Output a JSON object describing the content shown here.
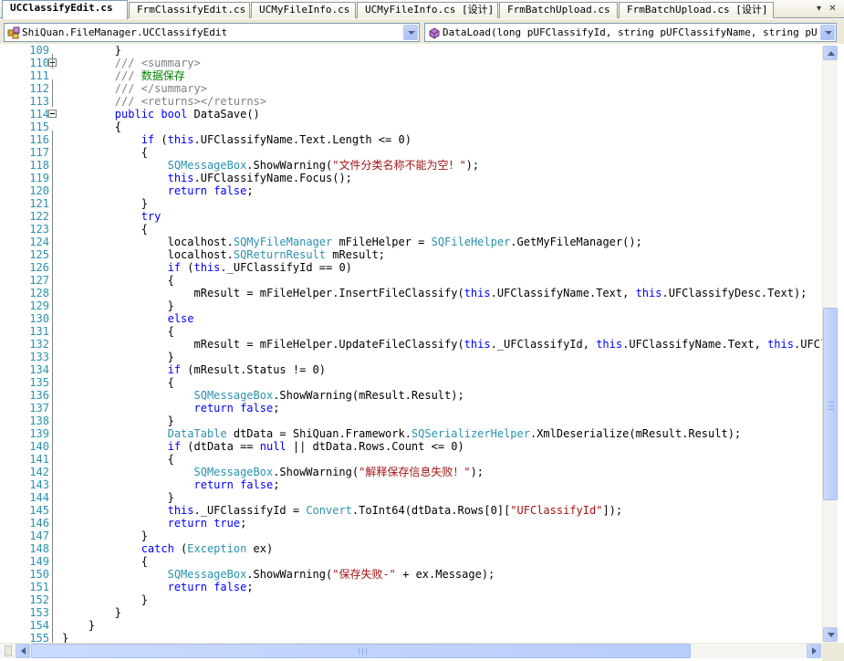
{
  "tabs": [
    {
      "label": "UCClassifyEdit.cs",
      "active": true
    },
    {
      "label": "FrmClassifyEdit.cs",
      "active": false
    },
    {
      "label": "UCMyFileInfo.cs",
      "active": false
    },
    {
      "label": "UCMyFileInfo.cs [设计]",
      "active": false
    },
    {
      "label": "FrmBatchUpload.cs",
      "active": false
    },
    {
      "label": "FrmBatchUpload.cs [设计]",
      "active": false
    }
  ],
  "tab_controls": {
    "dropdown_icon": "chevron-down-icon",
    "close_icon": "close-icon"
  },
  "navbar": {
    "class_combo": {
      "value": "ShiQuan.FileManager.UCClassifyEdit",
      "icon": "class-icon"
    },
    "member_combo": {
      "value": "DataLoad(long pUFClassifyId, string pUFClassifyName, string pUFClassifyDesc)",
      "icon": "method-icon"
    }
  },
  "colors": {
    "keyword": "#0000ff",
    "type": "#2b91af",
    "string": "#a31515",
    "comment": "#008000",
    "xmldoc": "#808080",
    "line_number": "#2b91af"
  },
  "editor": {
    "lines": [
      {
        "n": "109",
        "code": [
          [
            "p",
            "        }"
          ]
        ]
      },
      {
        "n": "110",
        "code": [
          [
            "x",
            "        ///"
          ],
          [
            "p",
            " "
          ],
          [
            "x",
            "<summary>"
          ]
        ]
      },
      {
        "n": "111",
        "code": [
          [
            "x",
            "        ///"
          ],
          [
            "c",
            " 数据保存"
          ]
        ]
      },
      {
        "n": "112",
        "code": [
          [
            "x",
            "        ///"
          ],
          [
            "p",
            " "
          ],
          [
            "x",
            "</summary>"
          ]
        ]
      },
      {
        "n": "113",
        "code": [
          [
            "x",
            "        ///"
          ],
          [
            "p",
            " "
          ],
          [
            "x",
            "<returns></returns>"
          ]
        ]
      },
      {
        "n": "114",
        "code": [
          [
            "k",
            "        public"
          ],
          [
            "p",
            " "
          ],
          [
            "k",
            "bool"
          ],
          [
            "p",
            " DataSave()"
          ]
        ]
      },
      {
        "n": "115",
        "code": [
          [
            "p",
            "        {"
          ]
        ]
      },
      {
        "n": "116",
        "code": [
          [
            "k",
            "            if"
          ],
          [
            "p",
            " ("
          ],
          [
            "k",
            "this"
          ],
          [
            "p",
            ".UFClassifyName.Text.Length <= 0)"
          ]
        ]
      },
      {
        "n": "117",
        "code": [
          [
            "p",
            "            {"
          ]
        ]
      },
      {
        "n": "118",
        "code": [
          [
            "t",
            "                SQMessageBox"
          ],
          [
            "p",
            ".ShowWarning("
          ],
          [
            "s",
            "\"文件分类名称不能为空！\""
          ],
          [
            "p",
            ");"
          ]
        ]
      },
      {
        "n": "119",
        "code": [
          [
            "k",
            "                this"
          ],
          [
            "p",
            ".UFClassifyName.Focus();"
          ]
        ]
      },
      {
        "n": "120",
        "code": [
          [
            "k",
            "                return"
          ],
          [
            "p",
            " "
          ],
          [
            "k",
            "false"
          ],
          [
            "p",
            ";"
          ]
        ]
      },
      {
        "n": "121",
        "code": [
          [
            "p",
            "            }"
          ]
        ]
      },
      {
        "n": "122",
        "code": [
          [
            "k",
            "            try"
          ]
        ]
      },
      {
        "n": "123",
        "code": [
          [
            "p",
            "            {"
          ]
        ]
      },
      {
        "n": "124",
        "code": [
          [
            "p",
            "                localhost."
          ],
          [
            "t",
            "SQMyFileManager"
          ],
          [
            "p",
            " mFileHelper = "
          ],
          [
            "t",
            "SQFileHelper"
          ],
          [
            "p",
            ".GetMyFileManager();"
          ]
        ]
      },
      {
        "n": "125",
        "code": [
          [
            "p",
            "                localhost."
          ],
          [
            "t",
            "SQReturnResult"
          ],
          [
            "p",
            " mResult;"
          ]
        ]
      },
      {
        "n": "126",
        "code": [
          [
            "k",
            "                if"
          ],
          [
            "p",
            " ("
          ],
          [
            "k",
            "this"
          ],
          [
            "p",
            "._UFClassifyId == 0)"
          ]
        ]
      },
      {
        "n": "127",
        "code": [
          [
            "p",
            "                {"
          ]
        ]
      },
      {
        "n": "128",
        "code": [
          [
            "p",
            "                    mResult = mFileHelper.InsertFileClassify("
          ],
          [
            "k",
            "this"
          ],
          [
            "p",
            ".UFClassifyName.Text, "
          ],
          [
            "k",
            "this"
          ],
          [
            "p",
            ".UFClassifyDesc.Text);"
          ]
        ]
      },
      {
        "n": "129",
        "code": [
          [
            "p",
            "                }"
          ]
        ]
      },
      {
        "n": "130",
        "code": [
          [
            "k",
            "                else"
          ]
        ]
      },
      {
        "n": "131",
        "code": [
          [
            "p",
            "                {"
          ]
        ]
      },
      {
        "n": "132",
        "code": [
          [
            "p",
            "                    mResult = mFileHelper.UpdateFileClassify("
          ],
          [
            "k",
            "this"
          ],
          [
            "p",
            "._UFClassifyId, "
          ],
          [
            "k",
            "this"
          ],
          [
            "p",
            ".UFClassifyName.Text, "
          ],
          [
            "k",
            "this"
          ],
          [
            "p",
            ".UFClassifyDesc.Text);"
          ]
        ]
      },
      {
        "n": "133",
        "code": [
          [
            "p",
            "                }"
          ]
        ]
      },
      {
        "n": "134",
        "code": [
          [
            "k",
            "                if"
          ],
          [
            "p",
            " (mResult.Status != 0)"
          ]
        ]
      },
      {
        "n": "135",
        "code": [
          [
            "p",
            "                {"
          ]
        ]
      },
      {
        "n": "136",
        "code": [
          [
            "t",
            "                    SQMessageBox"
          ],
          [
            "p",
            ".ShowWarning(mResult.Result);"
          ]
        ]
      },
      {
        "n": "137",
        "code": [
          [
            "k",
            "                    return"
          ],
          [
            "p",
            " "
          ],
          [
            "k",
            "false"
          ],
          [
            "p",
            ";"
          ]
        ]
      },
      {
        "n": "138",
        "code": [
          [
            "p",
            "                }"
          ]
        ]
      },
      {
        "n": "139",
        "code": [
          [
            "t",
            "                DataTable"
          ],
          [
            "p",
            " dtData = ShiQuan.Framework."
          ],
          [
            "t",
            "SQSerializerHelper"
          ],
          [
            "p",
            ".XmlDeserialize(mResult.Result);"
          ]
        ]
      },
      {
        "n": "140",
        "code": [
          [
            "k",
            "                if"
          ],
          [
            "p",
            " (dtData == "
          ],
          [
            "k",
            "null"
          ],
          [
            "p",
            " || dtData.Rows.Count <= 0)"
          ]
        ]
      },
      {
        "n": "141",
        "code": [
          [
            "p",
            "                {"
          ]
        ]
      },
      {
        "n": "142",
        "code": [
          [
            "t",
            "                    SQMessageBox"
          ],
          [
            "p",
            ".ShowWarning("
          ],
          [
            "s",
            "\"解释保存信息失败！\""
          ],
          [
            "p",
            ");"
          ]
        ]
      },
      {
        "n": "143",
        "code": [
          [
            "k",
            "                    return"
          ],
          [
            "p",
            " "
          ],
          [
            "k",
            "false"
          ],
          [
            "p",
            ";"
          ]
        ]
      },
      {
        "n": "144",
        "code": [
          [
            "p",
            "                }"
          ]
        ]
      },
      {
        "n": "145",
        "code": [
          [
            "k",
            "                this"
          ],
          [
            "p",
            "._UFClassifyId = "
          ],
          [
            "t",
            "Convert"
          ],
          [
            "p",
            ".ToInt64(dtData.Rows[0]["
          ],
          [
            "s",
            "\"UFClassifyId\""
          ],
          [
            "p",
            "]);"
          ]
        ]
      },
      {
        "n": "146",
        "code": [
          [
            "k",
            "                return"
          ],
          [
            "p",
            " "
          ],
          [
            "k",
            "true"
          ],
          [
            "p",
            ";"
          ]
        ]
      },
      {
        "n": "147",
        "code": [
          [
            "p",
            "            }"
          ]
        ]
      },
      {
        "n": "148",
        "code": [
          [
            "k",
            "            catch"
          ],
          [
            "p",
            " ("
          ],
          [
            "t",
            "Exception"
          ],
          [
            "p",
            " ex)"
          ]
        ]
      },
      {
        "n": "149",
        "code": [
          [
            "p",
            "            {"
          ]
        ]
      },
      {
        "n": "150",
        "code": [
          [
            "t",
            "                SQMessageBox"
          ],
          [
            "p",
            ".ShowWarning("
          ],
          [
            "s",
            "\"保存失败-\""
          ],
          [
            "p",
            " + ex.Message);"
          ]
        ]
      },
      {
        "n": "151",
        "code": [
          [
            "k",
            "                return"
          ],
          [
            "p",
            " "
          ],
          [
            "k",
            "false"
          ],
          [
            "p",
            ";"
          ]
        ]
      },
      {
        "n": "152",
        "code": [
          [
            "p",
            "            }"
          ]
        ]
      },
      {
        "n": "153",
        "code": [
          [
            "p",
            "        }"
          ]
        ]
      },
      {
        "n": "154",
        "code": [
          [
            "p",
            "    }"
          ]
        ]
      },
      {
        "n": "155",
        "code": [
          [
            "p",
            "}"
          ]
        ]
      }
    ]
  },
  "scrollbars": {
    "vertical_position": 0.66,
    "vertical_visible_fraction": 0.34,
    "horizontal_position": 0.0,
    "horizontal_visible_fraction": 0.85
  }
}
